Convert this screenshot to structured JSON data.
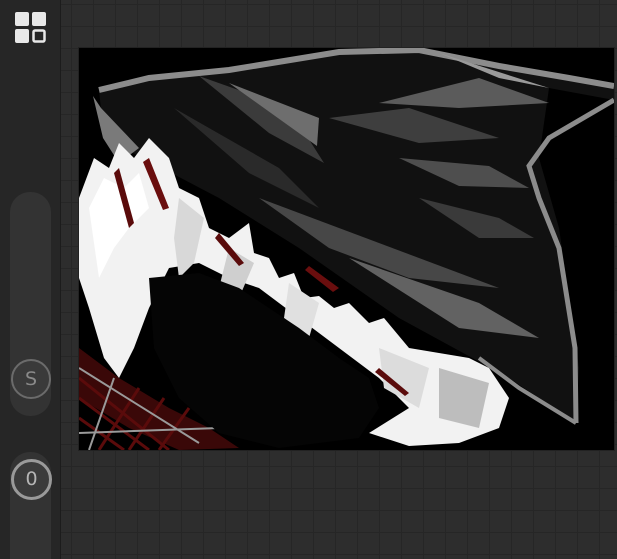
{
  "toolbar": {
    "grid_icon": "grid-layout-icon",
    "symmetry_label": "S",
    "counter_label": "0"
  },
  "canvas": {
    "artwork": "drawing-artwork",
    "colors": {
      "background": "#000000",
      "white": "#ffffff",
      "gray": "#8c8c8c",
      "dark_red": "#5a0b0b"
    }
  }
}
